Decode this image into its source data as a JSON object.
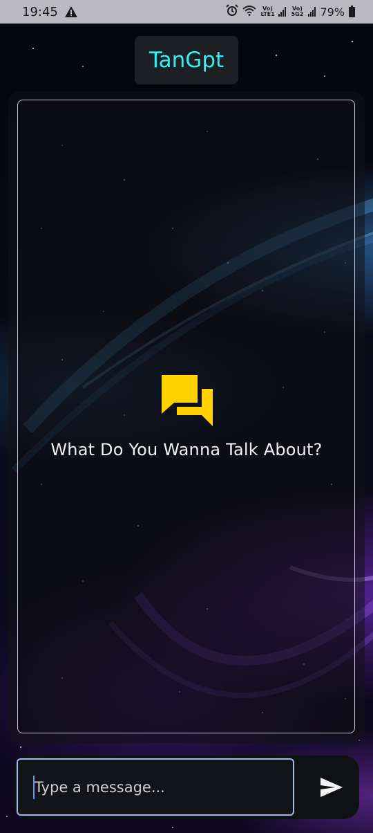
{
  "status_bar": {
    "time": "19:45",
    "net1": "Vo) LTE1",
    "net2": "Vo) 5G2",
    "battery": "79%",
    "icons": [
      "warning-icon",
      "alarm-icon",
      "wifi-icon",
      "signal-icon",
      "battery-icon"
    ]
  },
  "app": {
    "title": "TanGpt",
    "title_color": "#2ef2f2"
  },
  "chat": {
    "empty_icon": "chat-bubbles-icon",
    "empty_icon_color": "#ffd200",
    "empty_text": "What Do You Wanna Talk About?"
  },
  "composer": {
    "placeholder": "Type a message...",
    "value": "",
    "send_icon": "send-icon"
  }
}
